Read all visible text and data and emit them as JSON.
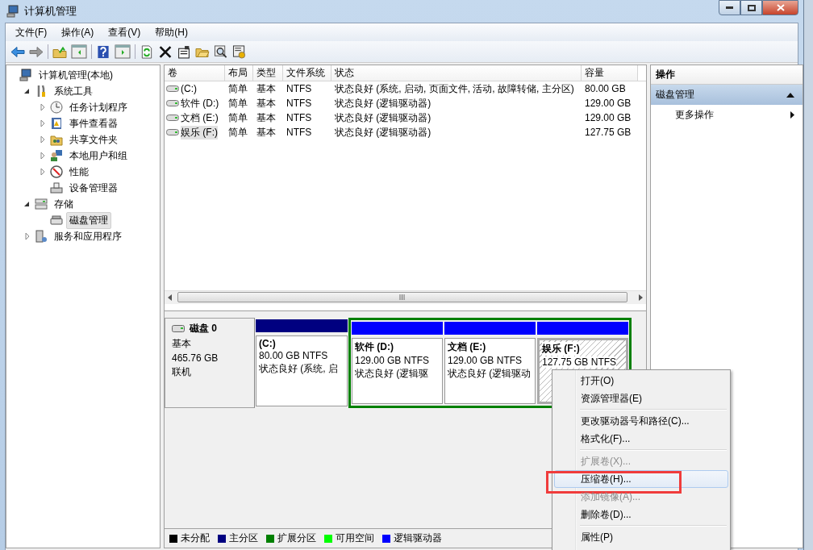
{
  "window": {
    "title": "计算机管理"
  },
  "menu": [
    "文件(F)",
    "操作(A)",
    "查看(V)",
    "帮助(H)"
  ],
  "tree": [
    {
      "label": "计算机管理(本地)",
      "selected": false,
      "children": [
        {
          "label": "系统工具",
          "selected": false,
          "expanded": true,
          "children": [
            {
              "label": "任务计划程序",
              "selected": false,
              "expanded": false
            },
            {
              "label": "事件查看器",
              "selected": false,
              "expanded": false
            },
            {
              "label": "共享文件夹",
              "selected": false,
              "expanded": false
            },
            {
              "label": "本地用户和组",
              "selected": false,
              "expanded": false
            },
            {
              "label": "性能",
              "selected": false,
              "expanded": false
            },
            {
              "label": "设备管理器",
              "selected": false
            }
          ]
        },
        {
          "label": "存储",
          "selected": false,
          "expanded": true,
          "children": [
            {
              "label": "磁盘管理",
              "selected": true
            }
          ]
        },
        {
          "label": "服务和应用程序",
          "selected": false,
          "expanded": false
        }
      ]
    }
  ],
  "table": {
    "columns": [
      "卷",
      "布局",
      "类型",
      "文件系统",
      "状态",
      "容量"
    ],
    "rows": [
      {
        "selected": false,
        "cells": [
          "(C:)",
          "简单",
          "基本",
          "NTFS",
          "状态良好 (系统, 启动, 页面文件, 活动, 故障转储, 主分区)",
          "80.00 GB"
        ]
      },
      {
        "selected": false,
        "cells": [
          "软件 (D:)",
          "简单",
          "基本",
          "NTFS",
          "状态良好 (逻辑驱动器)",
          "129.00 GB"
        ]
      },
      {
        "selected": false,
        "cells": [
          "文档 (E:)",
          "简单",
          "基本",
          "NTFS",
          "状态良好 (逻辑驱动器)",
          "129.00 GB"
        ]
      },
      {
        "selected": true,
        "cells": [
          "娱乐 (F:)",
          "简单",
          "基本",
          "NTFS",
          "状态良好 (逻辑驱动器)",
          "127.75 GB"
        ]
      }
    ]
  },
  "disk": {
    "name": "磁盘 0",
    "type": "基本",
    "size": "465.76 GB",
    "status": "联机",
    "partitions": [
      {
        "kind": "primary",
        "label": "(C:)",
        "size": "80.00 GB NTFS",
        "status": "状态良好 (系统, 启",
        "selected": false
      }
    ],
    "extended": [
      {
        "kind": "logical",
        "label": "软件 (D:)",
        "size": "129.00 GB NTFS",
        "status": "状态良好 (逻辑驱",
        "selected": false
      },
      {
        "kind": "logical",
        "label": "文档 (E:)",
        "size": "129.00 GB NTFS",
        "status": "状态良好 (逻辑驱动",
        "selected": false
      },
      {
        "kind": "logical",
        "label": "娱乐 (F:)",
        "size": "127.75 GB NTFS",
        "selected": true
      }
    ]
  },
  "legend": [
    {
      "label": "未分配",
      "color": "#000000"
    },
    {
      "label": "主分区",
      "color": "#000080"
    },
    {
      "label": "扩展分区",
      "color": "#008000"
    },
    {
      "label": "可用空间",
      "color": "#00ff00"
    },
    {
      "label": "逻辑驱动器",
      "color": "#0000ff"
    }
  ],
  "actions": {
    "title": "操作",
    "section": {
      "label": "磁盘管理",
      "expanded": true
    },
    "items": [
      "更多操作"
    ]
  },
  "context_menu": [
    {
      "kind": "item",
      "label": "打开(O)",
      "disabled": false,
      "hovered": false,
      "highlighted": false
    },
    {
      "kind": "item",
      "label": "资源管理器(E)",
      "disabled": false,
      "hovered": false,
      "highlighted": false
    },
    {
      "kind": "separator"
    },
    {
      "kind": "item",
      "label": "更改驱动器号和路径(C)...",
      "disabled": false,
      "hovered": false,
      "highlighted": false
    },
    {
      "kind": "item",
      "label": "格式化(F)...",
      "disabled": false,
      "hovered": false,
      "highlighted": false
    },
    {
      "kind": "separator"
    },
    {
      "kind": "item",
      "label": "扩展卷(X)...",
      "disabled": true,
      "hovered": false,
      "highlighted": false
    },
    {
      "kind": "item",
      "label": "压缩卷(H)...",
      "disabled": false,
      "hovered": true,
      "highlighted": true
    },
    {
      "kind": "item",
      "label": "添加镜像(A)...",
      "disabled": true,
      "hovered": false,
      "highlighted": false
    },
    {
      "kind": "item",
      "label": "删除卷(D)...",
      "disabled": false,
      "hovered": false,
      "highlighted": false
    },
    {
      "kind": "separator"
    },
    {
      "kind": "item",
      "label": "属性(P)",
      "disabled": false,
      "hovered": false,
      "highlighted": false
    }
  ]
}
